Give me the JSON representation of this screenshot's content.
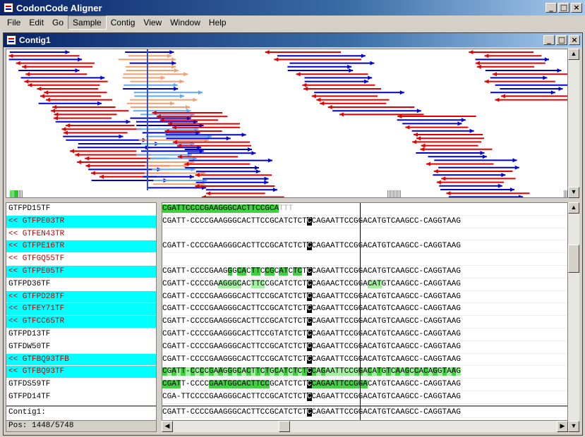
{
  "app": {
    "title": "CodonCode Aligner"
  },
  "menu": [
    "File",
    "Edit",
    "Go",
    "Sample",
    "Contig",
    "View",
    "Window",
    "Help"
  ],
  "menu_active": "Sample",
  "contig_window": {
    "title": "Contig1"
  },
  "reads": [
    {
      "name": "GTFPD15TF",
      "style": "plain",
      "seq": "CGATTCCCCGAAGGGCACTTCCGCATTT",
      "marks": "ggggggggggggggggggggggggggll"
    },
    {
      "name": "<< GTFPE03TR",
      "style": "cyan-red",
      "seq": "CGATT-CCCCGAAGGGCACTTCCGCATCTCTCCAGAATTCCGGACATGTCAAGCC-CAGGTAAG"
    },
    {
      "name": "<< GTFEN43TR",
      "style": "red",
      "seq": ""
    },
    {
      "name": "<< GTFPE16TR",
      "style": "cyan-red",
      "seq": "CGATT-CCCCGAAGGGCACTTCCGCATCTCTCCAGAATTCCGGACATGTCAAGCC-CAGGTAAG"
    },
    {
      "name": "<< GTFGQ55TF",
      "style": "red",
      "seq": ""
    },
    {
      "name": "<< GTFPE05TF",
      "style": "cyan-red",
      "seq": "CGATT-CCCCGAAGGGCACTTCCGCATCTCTCCAGAATTCCGGACATGTCAAGCC-CAGGTAAG"
    },
    {
      "name": "GTFPD36TF",
      "style": "plain",
      "seq": "CGATT-CCCCGAAGGGCACTTCCGCATCTCTCCAGAACTCCGGACATGTCAAGCC-CAGGTAAG"
    },
    {
      "name": "<< GTFPD28TF",
      "style": "cyan-red",
      "seq": "CGATT-CCCCGAAGGGCACTTCCGCATCTCTCCAGAATTCCGGACATGTCAAGCC-CAGGTAAG"
    },
    {
      "name": "<< GTFEY71TF",
      "style": "cyan-red",
      "seq": "CGATT-CCCCGAAGGGCACTTCCGCATCTCTCCAGAATTCCGGACATGTCAAGCC-CAGGTAAG"
    },
    {
      "name": "<< GTFCC65TR",
      "style": "cyan-red",
      "seq": "CGATT-CCCCGAAGGGCACTTCCGCATCTCTCCAGAATTCCGGACATGTCAAGCC-CAGGTAAG"
    },
    {
      "name": "GTFPD13TF",
      "style": "plain",
      "seq": "CGATT-CCCCGAAGGGCACTTCCGTATCTCTCCAGAATTCCGGACATGTCAAGCC-CAGGTAAG"
    },
    {
      "name": "GTFDW50TF",
      "style": "plain",
      "seq": "CGATT-CCCCGAAGGGCACTTCCGCATCTCTCCAGAATTCCGGACATGTCAAGCC-CAGGTAAG"
    },
    {
      "name": "<< GTFBQ93TFB",
      "style": "cyan-red",
      "seq": "CGATT-CCCCGAAGGGCACTTCCGCATCTCTCCAGAATTCCGGACATGTCAAGCC-CAGGTAAG"
    },
    {
      "name": "<< GTFBQ93TF",
      "style": "cyan-red",
      "seq": "CGATT-CCCCGAAGGGCACTTCTGCATCTCTCCAGAATTCCGGACATGTCAAGCCACAGGTAAG"
    },
    {
      "name": "GTFDS59TF",
      "style": "plain",
      "seq": "CGATT-CCCCGAATGGCACTTCCGCATCTCTCCAGAATTCCGGACATGTCAAGCC-CAGGTAAG"
    },
    {
      "name": "GTFPD14TF",
      "style": "plain",
      "seq": "CGA-TTCCCCGAAGGGCACTTCCGCATCTCTCCAGAATTCCGGACATGTCAAGCC-CAGGTAAG"
    }
  ],
  "consensus": {
    "name": "Contig1:",
    "seq": "CGATT-CCCCGAAGGGCACTTCCGCATCTCTCCAGAATTCCGGACATGTCAAGCC-CAGGTAAG"
  },
  "position": "Pos: 1448/5748"
}
